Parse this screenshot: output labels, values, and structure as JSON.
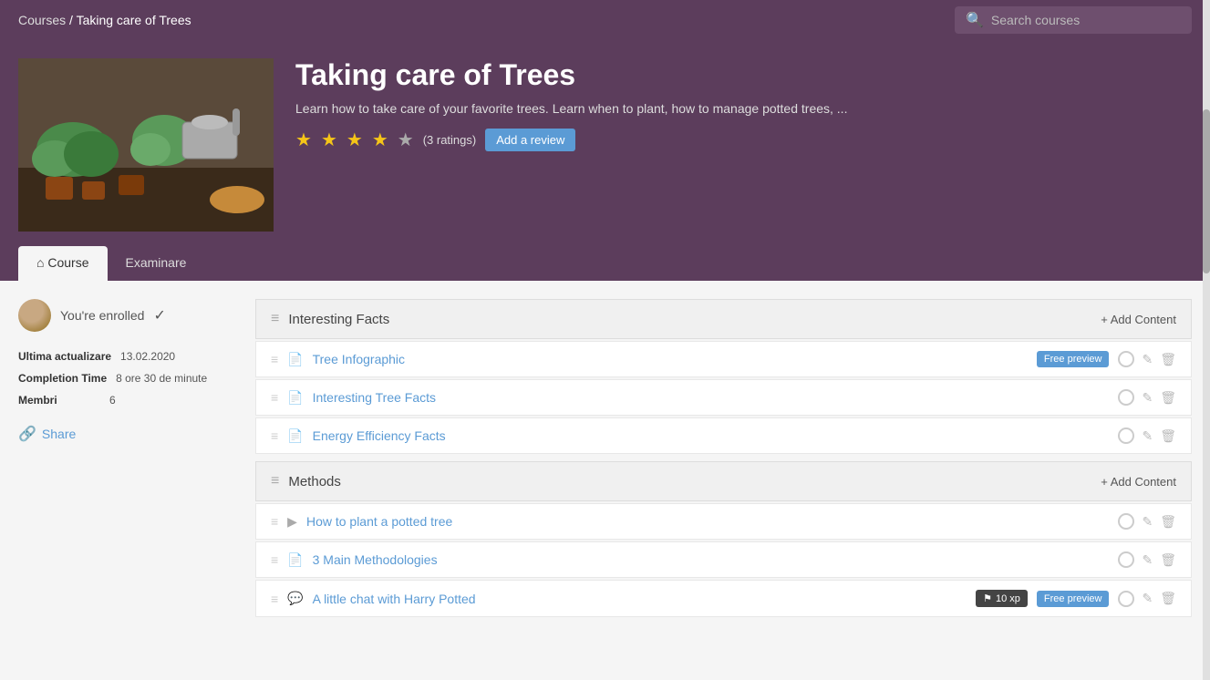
{
  "breadcrumb": {
    "courses_label": "Courses",
    "separator": "/",
    "current": "Taking care of Trees"
  },
  "search": {
    "placeholder": "Search courses"
  },
  "hero": {
    "title": "Taking care of Trees",
    "description": "Learn how to take care of your favorite trees. Learn when to plant, how to manage potted trees, ...",
    "rating_count": "(3 ratings)",
    "add_review_label": "Add a review",
    "stars": 4,
    "tabs": [
      {
        "label": "Course",
        "active": true
      },
      {
        "label": "Examinare",
        "active": false
      }
    ]
  },
  "sidebar": {
    "enrolled_label": "You're enrolled",
    "meta": [
      {
        "label": "Ultima actualizare",
        "value": "13.02.2020"
      },
      {
        "label": "Completion Time",
        "value": "8 ore 30 de minute"
      },
      {
        "label": "Membri",
        "value": "6"
      }
    ],
    "share_label": "Share"
  },
  "sections": [
    {
      "id": "interesting-facts",
      "title": "Interesting Facts",
      "add_content_label": "+ Add Content",
      "lessons": [
        {
          "title": "Tree Infographic",
          "type": "document",
          "free_preview": true,
          "free_preview_label": "Free preview",
          "xp": null
        },
        {
          "title": "Interesting Tree Facts",
          "type": "document",
          "free_preview": false,
          "xp": null
        },
        {
          "title": "Energy Efficiency Facts",
          "type": "document",
          "free_preview": false,
          "xp": null
        }
      ]
    },
    {
      "id": "methods",
      "title": "Methods",
      "add_content_label": "+ Add Content",
      "lessons": [
        {
          "title": "How to plant a potted tree",
          "type": "video",
          "free_preview": false,
          "xp": null
        },
        {
          "title": "3 Main Methodologies",
          "type": "document",
          "free_preview": false,
          "xp": null
        },
        {
          "title": "A little chat with Harry Potted",
          "type": "chat",
          "free_preview": true,
          "free_preview_label": "Free preview",
          "xp": 10,
          "xp_label": "10 xp"
        }
      ]
    }
  ]
}
